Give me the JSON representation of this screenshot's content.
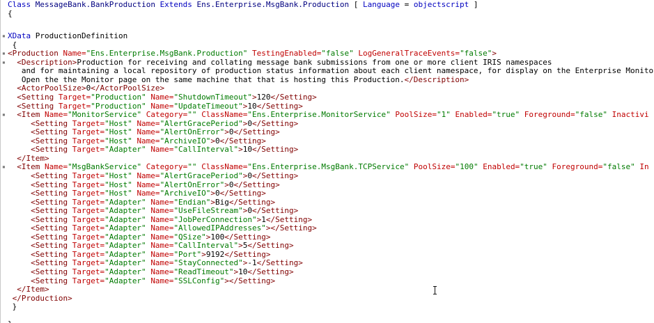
{
  "window": {
    "title": ""
  },
  "colors": {
    "keyword": "#0000c0",
    "tag": "#800000",
    "attribute": "#c00000",
    "string": "#007a00",
    "text": "#000000"
  },
  "lines": [
    {
      "indent": 0,
      "fold": false,
      "tokens": [
        [
          "kw",
          "Class "
        ],
        [
          "ty",
          "MessageBank.BankProduction "
        ],
        [
          "kw",
          "Extends "
        ],
        [
          "ty",
          "Ens.Enterprise.MsgBank.Production "
        ],
        [
          "punc",
          "[ "
        ],
        [
          "kw",
          "Language "
        ],
        [
          "punc",
          "= "
        ],
        [
          "kw",
          "objectscript"
        ],
        [
          "punc",
          " ]"
        ]
      ]
    },
    {
      "indent": 0,
      "fold": false,
      "tokens": [
        [
          "punc",
          "{"
        ]
      ]
    },
    {
      "indent": 0,
      "fold": false,
      "tokens": []
    },
    {
      "indent": 0,
      "fold": true,
      "tokens": [
        [
          "kw",
          "XData "
        ],
        [
          "txt",
          "ProductionDefinition"
        ]
      ]
    },
    {
      "indent": 0,
      "fold": false,
      "tokens": [
        [
          "punc",
          " {"
        ]
      ]
    },
    {
      "indent": 0,
      "fold": true,
      "tokens": [
        [
          "tag",
          "<Production "
        ],
        [
          "attr",
          "Name="
        ],
        [
          "str",
          "\"Ens.Enterprise.MsgBank.Production\" "
        ],
        [
          "attr",
          "TestingEnabled="
        ],
        [
          "str",
          "\"false\" "
        ],
        [
          "attr",
          "LogGeneralTraceEvents="
        ],
        [
          "str",
          "\"false\""
        ],
        [
          "tag",
          ">"
        ]
      ]
    },
    {
      "indent": 0,
      "fold": true,
      "tokens": [
        [
          "tag",
          "  <Description>"
        ],
        [
          "txt",
          "Production for receiving and collating message bank submissions from one or more client IRIS namespaces"
        ]
      ]
    },
    {
      "indent": 0,
      "fold": false,
      "tokens": [
        [
          "txt",
          "   and for maintaining a local repository of production status information about each client namespace, for display on the Enterprise Monito"
        ]
      ]
    },
    {
      "indent": 0,
      "fold": false,
      "tokens": [
        [
          "txt",
          "   Open the the Monitor page on the same machine that that is hosting this Production."
        ],
        [
          "tag",
          "</Description>"
        ]
      ]
    },
    {
      "indent": 0,
      "fold": false,
      "tokens": [
        [
          "tag",
          "  <ActorPoolSize>"
        ],
        [
          "txt",
          "0"
        ],
        [
          "tag",
          "</ActorPoolSize>"
        ]
      ]
    },
    {
      "indent": 0,
      "fold": false,
      "tokens": [
        [
          "tag",
          "  <Setting "
        ],
        [
          "attr",
          "Target="
        ],
        [
          "str",
          "\"Production\" "
        ],
        [
          "attr",
          "Name="
        ],
        [
          "str",
          "\"ShutdownTimeout\""
        ],
        [
          "tag",
          ">"
        ],
        [
          "txt",
          "120"
        ],
        [
          "tag",
          "</Setting>"
        ]
      ]
    },
    {
      "indent": 0,
      "fold": false,
      "tokens": [
        [
          "tag",
          "  <Setting "
        ],
        [
          "attr",
          "Target="
        ],
        [
          "str",
          "\"Production\" "
        ],
        [
          "attr",
          "Name="
        ],
        [
          "str",
          "\"UpdateTimeout\""
        ],
        [
          "tag",
          ">"
        ],
        [
          "txt",
          "10"
        ],
        [
          "tag",
          "</Setting>"
        ]
      ]
    },
    {
      "indent": 0,
      "fold": true,
      "tokens": [
        [
          "tag",
          "  <Item "
        ],
        [
          "attr",
          "Name="
        ],
        [
          "str",
          "\"MonitorService\" "
        ],
        [
          "attr",
          "Category="
        ],
        [
          "str",
          "\"\" "
        ],
        [
          "attr",
          "ClassName="
        ],
        [
          "str",
          "\"Ens.Enterprise.MonitorService\" "
        ],
        [
          "attr",
          "PoolSize="
        ],
        [
          "str",
          "\"1\" "
        ],
        [
          "attr",
          "Enabled="
        ],
        [
          "str",
          "\"true\" "
        ],
        [
          "attr",
          "Foreground="
        ],
        [
          "str",
          "\"false\" "
        ],
        [
          "attr",
          "Inactivi"
        ]
      ]
    },
    {
      "indent": 0,
      "fold": false,
      "tokens": [
        [
          "tag",
          "     <Setting "
        ],
        [
          "attr",
          "Target="
        ],
        [
          "str",
          "\"Host\" "
        ],
        [
          "attr",
          "Name="
        ],
        [
          "str",
          "\"AlertGracePeriod\""
        ],
        [
          "tag",
          ">"
        ],
        [
          "txt",
          "0"
        ],
        [
          "tag",
          "</Setting>"
        ]
      ]
    },
    {
      "indent": 0,
      "fold": false,
      "tokens": [
        [
          "tag",
          "     <Setting "
        ],
        [
          "attr",
          "Target="
        ],
        [
          "str",
          "\"Host\" "
        ],
        [
          "attr",
          "Name="
        ],
        [
          "str",
          "\"AlertOnError\""
        ],
        [
          "tag",
          ">"
        ],
        [
          "txt",
          "0"
        ],
        [
          "tag",
          "</Setting>"
        ]
      ]
    },
    {
      "indent": 0,
      "fold": false,
      "tokens": [
        [
          "tag",
          "     <Setting "
        ],
        [
          "attr",
          "Target="
        ],
        [
          "str",
          "\"Host\" "
        ],
        [
          "attr",
          "Name="
        ],
        [
          "str",
          "\"ArchiveIO\""
        ],
        [
          "tag",
          ">"
        ],
        [
          "txt",
          "0"
        ],
        [
          "tag",
          "</Setting>"
        ]
      ]
    },
    {
      "indent": 0,
      "fold": false,
      "tokens": [
        [
          "tag",
          "     <Setting "
        ],
        [
          "attr",
          "Target="
        ],
        [
          "str",
          "\"Adapter\" "
        ],
        [
          "attr",
          "Name="
        ],
        [
          "str",
          "\"CallInterval\""
        ],
        [
          "tag",
          ">"
        ],
        [
          "txt",
          "10"
        ],
        [
          "tag",
          "</Setting>"
        ]
      ]
    },
    {
      "indent": 0,
      "fold": false,
      "tokens": [
        [
          "tag",
          "  </Item>"
        ]
      ]
    },
    {
      "indent": 0,
      "fold": true,
      "tokens": [
        [
          "tag",
          "  <Item "
        ],
        [
          "attr",
          "Name="
        ],
        [
          "str",
          "\"MsgBankService\" "
        ],
        [
          "attr",
          "Category="
        ],
        [
          "str",
          "\"\" "
        ],
        [
          "attr",
          "ClassName="
        ],
        [
          "str",
          "\"Ens.Enterprise.MsgBank.TCPService\" "
        ],
        [
          "attr",
          "PoolSize="
        ],
        [
          "str",
          "\"100\" "
        ],
        [
          "attr",
          "Enabled="
        ],
        [
          "str",
          "\"true\" "
        ],
        [
          "attr",
          "Foreground="
        ],
        [
          "str",
          "\"false\" "
        ],
        [
          "attr",
          "In"
        ]
      ]
    },
    {
      "indent": 0,
      "fold": false,
      "tokens": [
        [
          "tag",
          "     <Setting "
        ],
        [
          "attr",
          "Target="
        ],
        [
          "str",
          "\"Host\" "
        ],
        [
          "attr",
          "Name="
        ],
        [
          "str",
          "\"AlertGracePeriod\""
        ],
        [
          "tag",
          ">"
        ],
        [
          "txt",
          "0"
        ],
        [
          "tag",
          "</Setting>"
        ]
      ]
    },
    {
      "indent": 0,
      "fold": false,
      "tokens": [
        [
          "tag",
          "     <Setting "
        ],
        [
          "attr",
          "Target="
        ],
        [
          "str",
          "\"Host\" "
        ],
        [
          "attr",
          "Name="
        ],
        [
          "str",
          "\"AlertOnError\""
        ],
        [
          "tag",
          ">"
        ],
        [
          "txt",
          "0"
        ],
        [
          "tag",
          "</Setting>"
        ]
      ]
    },
    {
      "indent": 0,
      "fold": false,
      "tokens": [
        [
          "tag",
          "     <Setting "
        ],
        [
          "attr",
          "Target="
        ],
        [
          "str",
          "\"Host\" "
        ],
        [
          "attr",
          "Name="
        ],
        [
          "str",
          "\"ArchiveIO\""
        ],
        [
          "tag",
          ">"
        ],
        [
          "txt",
          "0"
        ],
        [
          "tag",
          "</Setting>"
        ]
      ]
    },
    {
      "indent": 0,
      "fold": false,
      "tokens": [
        [
          "tag",
          "     <Setting "
        ],
        [
          "attr",
          "Target="
        ],
        [
          "str",
          "\"Adapter\" "
        ],
        [
          "attr",
          "Name="
        ],
        [
          "str",
          "\"Endian\""
        ],
        [
          "tag",
          ">"
        ],
        [
          "txt",
          "Big"
        ],
        [
          "tag",
          "</Setting>"
        ]
      ]
    },
    {
      "indent": 0,
      "fold": false,
      "tokens": [
        [
          "tag",
          "     <Setting "
        ],
        [
          "attr",
          "Target="
        ],
        [
          "str",
          "\"Adapter\" "
        ],
        [
          "attr",
          "Name="
        ],
        [
          "str",
          "\"UseFileStream\""
        ],
        [
          "tag",
          ">"
        ],
        [
          "txt",
          "0"
        ],
        [
          "tag",
          "</Setting>"
        ]
      ]
    },
    {
      "indent": 0,
      "fold": false,
      "tokens": [
        [
          "tag",
          "     <Setting "
        ],
        [
          "attr",
          "Target="
        ],
        [
          "str",
          "\"Adapter\" "
        ],
        [
          "attr",
          "Name="
        ],
        [
          "str",
          "\"JobPerConnection\""
        ],
        [
          "tag",
          ">"
        ],
        [
          "txt",
          "1"
        ],
        [
          "tag",
          "</Setting>"
        ]
      ]
    },
    {
      "indent": 0,
      "fold": false,
      "tokens": [
        [
          "tag",
          "     <Setting "
        ],
        [
          "attr",
          "Target="
        ],
        [
          "str",
          "\"Adapter\" "
        ],
        [
          "attr",
          "Name="
        ],
        [
          "str",
          "\"AllowedIPAddresses\""
        ],
        [
          "tag",
          "></Setting>"
        ]
      ]
    },
    {
      "indent": 0,
      "fold": false,
      "tokens": [
        [
          "tag",
          "     <Setting "
        ],
        [
          "attr",
          "Target="
        ],
        [
          "str",
          "\"Adapter\" "
        ],
        [
          "attr",
          "Name="
        ],
        [
          "str",
          "\"QSize\""
        ],
        [
          "tag",
          ">"
        ],
        [
          "txt",
          "100"
        ],
        [
          "tag",
          "</Setting>"
        ]
      ]
    },
    {
      "indent": 0,
      "fold": false,
      "tokens": [
        [
          "tag",
          "     <Setting "
        ],
        [
          "attr",
          "Target="
        ],
        [
          "str",
          "\"Adapter\" "
        ],
        [
          "attr",
          "Name="
        ],
        [
          "str",
          "\"CallInterval\""
        ],
        [
          "tag",
          ">"
        ],
        [
          "txt",
          "5"
        ],
        [
          "tag",
          "</Setting>"
        ]
      ]
    },
    {
      "indent": 0,
      "fold": false,
      "tokens": [
        [
          "tag",
          "     <Setting "
        ],
        [
          "attr",
          "Target="
        ],
        [
          "str",
          "\"Adapter\" "
        ],
        [
          "attr",
          "Name="
        ],
        [
          "str",
          "\"Port\""
        ],
        [
          "tag",
          ">"
        ],
        [
          "txt",
          "9192"
        ],
        [
          "tag",
          "</Setting>"
        ]
      ]
    },
    {
      "indent": 0,
      "fold": false,
      "tokens": [
        [
          "tag",
          "     <Setting "
        ],
        [
          "attr",
          "Target="
        ],
        [
          "str",
          "\"Adapter\" "
        ],
        [
          "attr",
          "Name="
        ],
        [
          "str",
          "\"StayConnected\""
        ],
        [
          "tag",
          ">"
        ],
        [
          "txt",
          "-1"
        ],
        [
          "tag",
          "</Setting>"
        ]
      ]
    },
    {
      "indent": 0,
      "fold": false,
      "tokens": [
        [
          "tag",
          "     <Setting "
        ],
        [
          "attr",
          "Target="
        ],
        [
          "str",
          "\"Adapter\" "
        ],
        [
          "attr",
          "Name="
        ],
        [
          "str",
          "\"ReadTimeout\""
        ],
        [
          "tag",
          ">"
        ],
        [
          "txt",
          "10"
        ],
        [
          "tag",
          "</Setting>"
        ]
      ]
    },
    {
      "indent": 0,
      "fold": false,
      "tokens": [
        [
          "tag",
          "     <Setting "
        ],
        [
          "attr",
          "Target="
        ],
        [
          "str",
          "\"Adapter\" "
        ],
        [
          "attr",
          "Name="
        ],
        [
          "str",
          "\"SSLConfig\""
        ],
        [
          "tag",
          "></Setting>"
        ]
      ]
    },
    {
      "indent": 0,
      "fold": false,
      "tokens": [
        [
          "tag",
          "  </Item>"
        ]
      ]
    },
    {
      "indent": 0,
      "fold": false,
      "tokens": [
        [
          "tag",
          " </Production>"
        ]
      ]
    },
    {
      "indent": 0,
      "fold": false,
      "tokens": [
        [
          "punc",
          " }"
        ]
      ]
    },
    {
      "indent": 0,
      "fold": false,
      "tokens": []
    },
    {
      "indent": 0,
      "fold": false,
      "tokens": [
        [
          "punc",
          "}"
        ]
      ]
    }
  ]
}
